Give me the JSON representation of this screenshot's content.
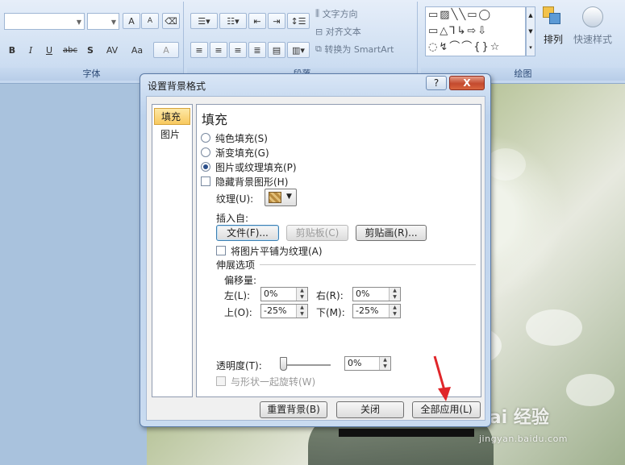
{
  "ribbon": {
    "font_group_label": "字体",
    "paragraph_group_label": "段落",
    "drawing_group_label": "绘图",
    "font_grow": "A",
    "font_shrink": "A",
    "bold": "B",
    "italic": "I",
    "underline": "U",
    "strikethrough": "abc",
    "shadow": "S",
    "char_spacing": "AV",
    "change_case": "Aa",
    "font_color": "A",
    "text_direction": "文字方向",
    "align_text": "对齐文本",
    "convert_smartart": "转换为 SmartArt",
    "arrange": "排列",
    "quick_styles": "快速样式"
  },
  "dialog": {
    "title": "设置背景格式",
    "help": "?",
    "close": "X",
    "nav": [
      "填充",
      "图片"
    ],
    "panel_title": "填充",
    "options": {
      "solid": "纯色填充(S)",
      "gradient": "渐变填充(G)",
      "picture": "图片或纹理填充(P)",
      "hide_bg": "隐藏背景图形(H)"
    },
    "texture_label": "纹理(U):",
    "insert_from_label": "插入自:",
    "file_btn": "文件(F)...",
    "clipboard_btn": "剪贴板(C)",
    "clipart_btn": "剪贴画(R)...",
    "tile_label": "将图片平铺为纹理(A)",
    "stretch_label": "伸展选项",
    "offset_label": "偏移量:",
    "left_label": "左(L):",
    "left_value": "0%",
    "right_label": "右(R):",
    "right_value": "0%",
    "top_label": "上(O):",
    "top_value": "-25%",
    "bottom_label": "下(M):",
    "bottom_value": "-25%",
    "transparency_label": "透明度(T):",
    "transparency_value": "0%",
    "rotate_label": "与形状一起旋转(W)",
    "reset_btn": "重置背景(B)",
    "close_btn": "关闭",
    "apply_all_btn": "全部应用(L)"
  },
  "watermark": {
    "brand": "Bai 经验",
    "url": "jingyan.baidu.com"
  },
  "colors": {
    "arrow": "#e0262a"
  }
}
